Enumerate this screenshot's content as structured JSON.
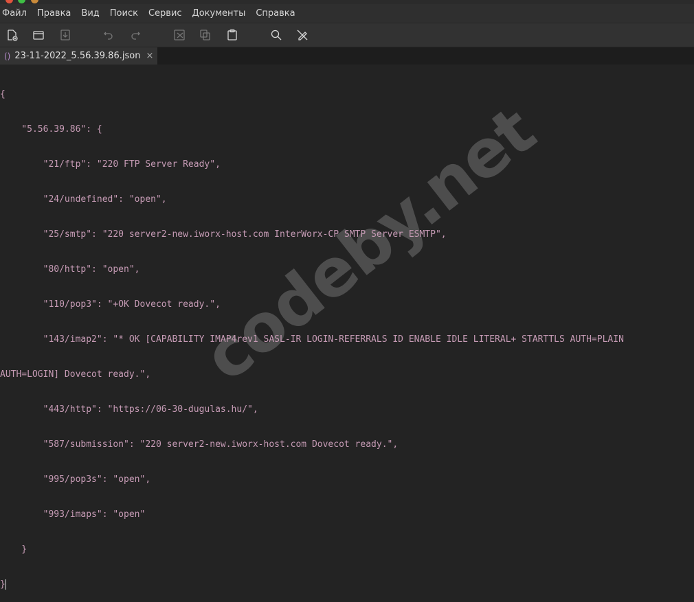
{
  "menu": [
    "Файл",
    "Правка",
    "Вид",
    "Поиск",
    "Сервис",
    "Документы",
    "Справка"
  ],
  "toolbar": [
    {
      "icon": "new-document-icon",
      "enabled": true
    },
    {
      "icon": "open-folder-icon",
      "enabled": true
    },
    {
      "icon": "save-icon",
      "enabled": false
    },
    {
      "icon": "undo-icon",
      "enabled": false
    },
    {
      "icon": "redo-icon",
      "enabled": false
    },
    {
      "icon": "cut-icon",
      "enabled": false
    },
    {
      "icon": "copy-icon",
      "enabled": false
    },
    {
      "icon": "paste-icon",
      "enabled": true
    },
    {
      "icon": "search-icon",
      "enabled": true
    },
    {
      "icon": "spellcheck-icon",
      "enabled": true
    }
  ],
  "tab": {
    "icon": "json-braces-icon",
    "icon_text": "()",
    "title": "23-11-2022_5.56.39.86.json",
    "close": "×"
  },
  "editor": {
    "lines": [
      "{",
      "    \"5.56.39.86\": {",
      "        \"21/ftp\": \"220 FTP Server Ready\",",
      "        \"24/undefined\": \"open\",",
      "        \"25/smtp\": \"220 server2-new.iworx-host.com InterWorx-CP SMTP Server ESMTP\",",
      "        \"80/http\": \"open\",",
      "        \"110/pop3\": \"+OK Dovecot ready.\",",
      "        \"143/imap2\": \"* OK [CAPABILITY IMAP4rev1 SASL-IR LOGIN-REFERRALS ID ENABLE IDLE LITERAL+ STARTTLS AUTH=PLAIN",
      "AUTH=LOGIN] Dovecot ready.\",",
      "        \"443/http\": \"https://06-30-dugulas.hu/\",",
      "        \"587/submission\": \"220 server2-new.iworx-host.com Dovecot ready.\",",
      "        \"995/pop3s\": \"open\",",
      "        \"993/imaps\": \"open\"",
      "    }",
      "}"
    ]
  },
  "watermark": "codeby.net",
  "colors": {
    "string": "#c69bb5",
    "punctuation": "#dccb8f",
    "background": "#232323"
  }
}
